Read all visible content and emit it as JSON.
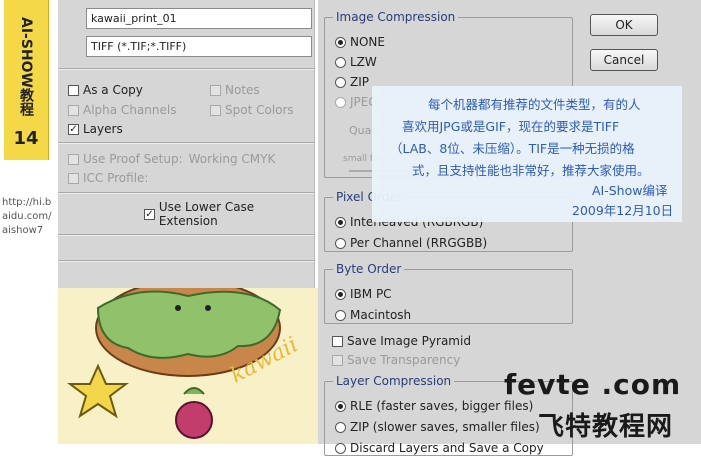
{
  "strip": {
    "vertical_text": "AI-SHOW教程",
    "number": "14",
    "url": "http://hi.b\naidu.com/\naishow7"
  },
  "left_panel": {
    "filename": "kawaii_print_01",
    "format": "TIFF (*.TIF;*.TIFF)",
    "as_a_copy": "As a Copy",
    "notes": "Notes",
    "alpha_channels": "Alpha Channels",
    "spot_colors": "Spot Colors",
    "layers": "Layers",
    "use_proof_setup": "Use Proof Setup:",
    "proof_value": "Working CMYK",
    "icc_profile": "ICC Profile:",
    "lower_case_ext": "Use Lower Case Extension"
  },
  "buttons": {
    "ok": "OK",
    "cancel": "Cancel"
  },
  "image_compression": {
    "title": "Image Compression",
    "options": [
      "NONE",
      "LZW",
      "ZIP",
      "JPEG"
    ],
    "quality_label": "Quali",
    "small_file": "small file"
  },
  "pixel_order": {
    "title": "Pixel Order",
    "interleaved": "Interleaved (RGBRGB)",
    "per_channel": "Per Channel (RRGGBB)"
  },
  "byte_order": {
    "title": "Byte Order",
    "ibm": "IBM PC",
    "mac": "Macintosh"
  },
  "pyramid": {
    "save_pyramid": "Save Image Pyramid",
    "save_transparency": "Save Transparency"
  },
  "layer_compression": {
    "title": "Layer Compression",
    "rle": "RLE (faster saves, bigger files)",
    "zip": "ZIP (slower saves, smaller files)",
    "discard": "Discard Layers and Save a Copy"
  },
  "note": {
    "line1": "每个机器都有推荐的文件类型，有的人",
    "line2": "喜欢用JPG或是GIF，现在的要求是TIFF",
    "line3": "（LAB、8位、未压缩）。TIF是一种无损的格",
    "line4": "式，且支持性能也非常好，推荐大家使用。",
    "author": "AI-Show编译",
    "date": "2009年12月10日"
  },
  "image": {
    "signature": "kawaii"
  },
  "watermark": {
    "site": "fevte .com",
    "name": "飞特教程网"
  },
  "colors": {
    "accent": "#2456b8",
    "strip": "#f4d848",
    "dialog": "#d6d6d6"
  }
}
